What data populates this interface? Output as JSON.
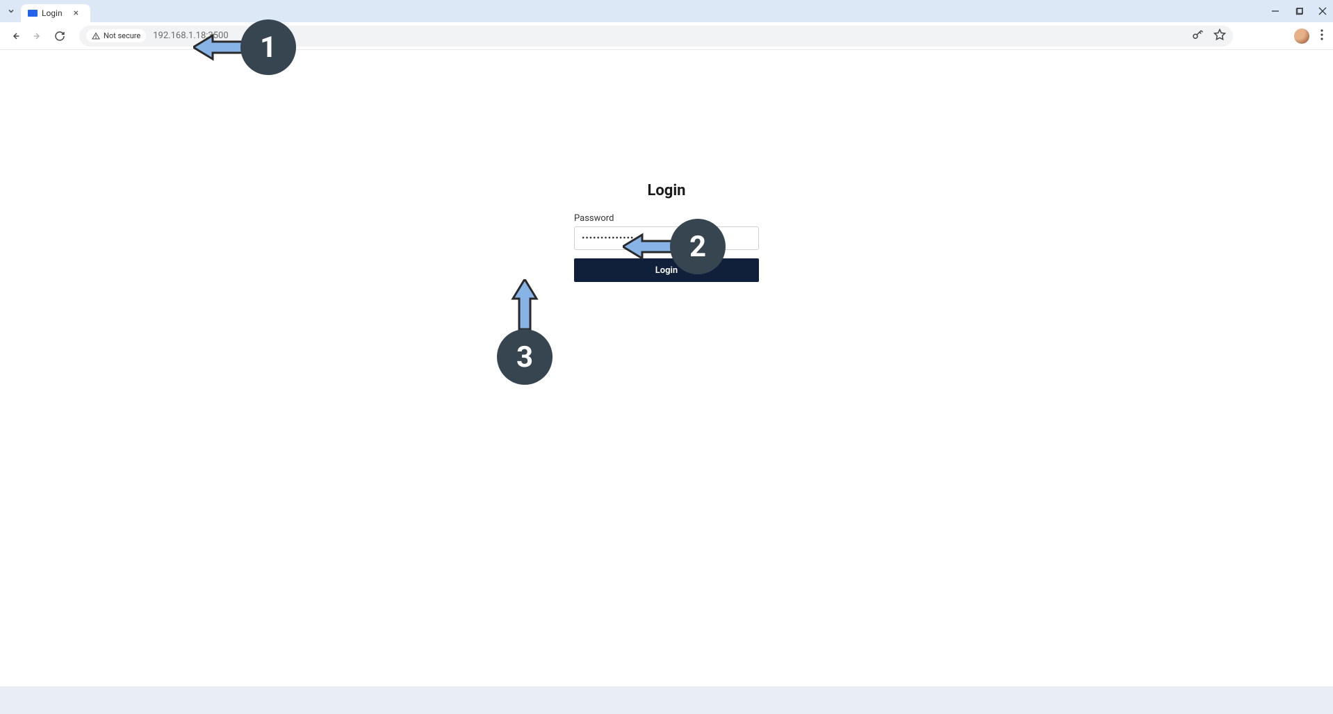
{
  "browser": {
    "tab_title": "Login",
    "security_label": "Not secure",
    "url": "192.168.1.18:3500"
  },
  "page": {
    "login_title": "Login",
    "password_label": "Password",
    "password_value": "••••••••••••••",
    "login_button_label": "Login"
  },
  "annotations": {
    "marker_1": "1",
    "marker_2": "2",
    "marker_3": "3"
  }
}
